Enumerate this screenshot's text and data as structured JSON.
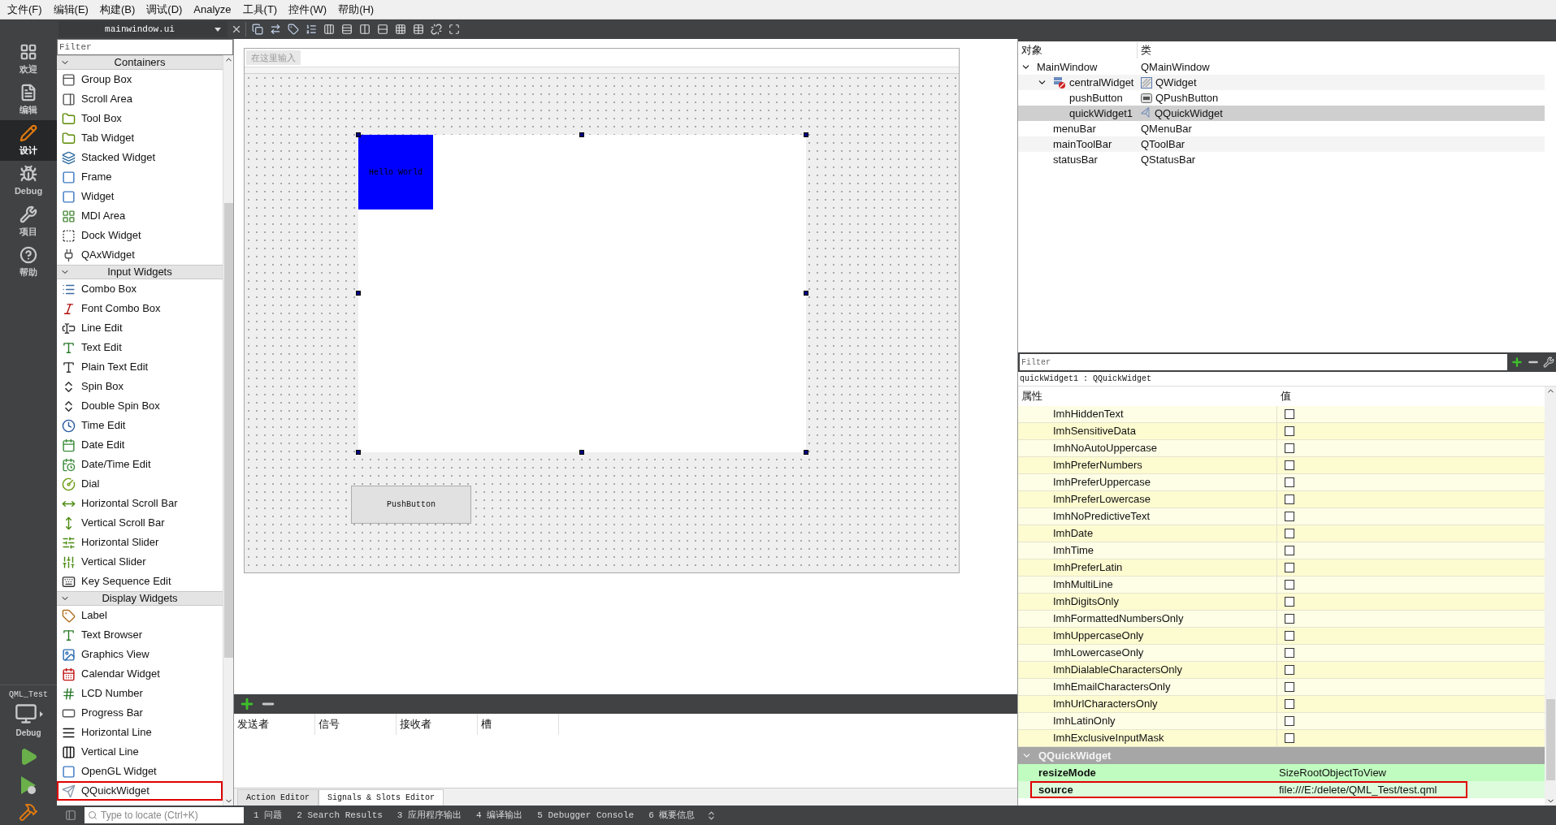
{
  "menu_bar": [
    "文件(F)",
    "编辑(E)",
    "构建(B)",
    "调试(D)",
    "Analyze",
    "工具(T)",
    "控件(W)",
    "帮助(H)"
  ],
  "editor_toolbar": {
    "file": "mainwindow.ui"
  },
  "mode_bar": [
    {
      "label": "欢迎",
      "selected": false
    },
    {
      "label": "编辑",
      "selected": false
    },
    {
      "label": "设计",
      "selected": true
    },
    {
      "label": "Debug",
      "selected": false
    },
    {
      "label": "项目",
      "selected": false
    },
    {
      "label": "帮助",
      "selected": false
    }
  ],
  "kit": {
    "project": "QML_Test",
    "build": "Debug"
  },
  "widget_box": {
    "filter": {
      "placeholder": "Filter"
    },
    "categories": [
      {
        "title": "Containers",
        "expanded": true,
        "items": [
          {
            "label": "Group Box",
            "highlighted": false
          },
          {
            "label": "Scroll Area",
            "highlighted": false
          },
          {
            "label": "Tool Box",
            "highlighted": false
          },
          {
            "label": "Tab Widget",
            "highlighted": false
          },
          {
            "label": "Stacked Widget",
            "highlighted": false
          },
          {
            "label": "Frame",
            "highlighted": false
          },
          {
            "label": "Widget",
            "highlighted": false
          },
          {
            "label": "MDI Area",
            "highlighted": false
          },
          {
            "label": "Dock Widget",
            "highlighted": false
          },
          {
            "label": "QAxWidget",
            "highlighted": false
          }
        ]
      },
      {
        "title": "Input Widgets",
        "expanded": true,
        "items": [
          {
            "label": "Combo Box",
            "highlighted": false
          },
          {
            "label": "Font Combo Box",
            "highlighted": false
          },
          {
            "label": "Line Edit",
            "highlighted": false
          },
          {
            "label": "Text Edit",
            "highlighted": false
          },
          {
            "label": "Plain Text Edit",
            "highlighted": false
          },
          {
            "label": "Spin Box",
            "highlighted": false
          },
          {
            "label": "Double Spin Box",
            "highlighted": false
          },
          {
            "label": "Time Edit",
            "highlighted": false
          },
          {
            "label": "Date Edit",
            "highlighted": false
          },
          {
            "label": "Date/Time Edit",
            "highlighted": false
          },
          {
            "label": "Dial",
            "highlighted": false
          },
          {
            "label": "Horizontal Scroll Bar",
            "highlighted": false
          },
          {
            "label": "Vertical Scroll Bar",
            "highlighted": false
          },
          {
            "label": "Horizontal Slider",
            "highlighted": false
          },
          {
            "label": "Vertical Slider",
            "highlighted": false
          },
          {
            "label": "Key Sequence Edit",
            "highlighted": false
          }
        ]
      },
      {
        "title": "Display Widgets",
        "expanded": true,
        "items": [
          {
            "label": "Label",
            "highlighted": false
          },
          {
            "label": "Text Browser",
            "highlighted": false
          },
          {
            "label": "Graphics View",
            "highlighted": false
          },
          {
            "label": "Calendar Widget",
            "highlighted": false
          },
          {
            "label": "LCD Number",
            "highlighted": false
          },
          {
            "label": "Progress Bar",
            "highlighted": false
          },
          {
            "label": "Horizontal Line",
            "highlighted": false
          },
          {
            "label": "Vertical Line",
            "highlighted": false
          },
          {
            "label": "OpenGL Widget",
            "highlighted": false
          },
          {
            "label": "QQuickWidget",
            "highlighted": true
          }
        ]
      }
    ]
  },
  "form": {
    "menu_placeholder": "在这里输入",
    "quick_text": "Hello World",
    "push_button": "PushButton"
  },
  "signal_slot": {
    "columns": [
      "发送者",
      "信号",
      "接收者",
      "槽"
    ],
    "tabs": [
      {
        "label": "Action Editor",
        "selected": false
      },
      {
        "label": "Signals & Slots Editor",
        "selected": true
      }
    ]
  },
  "object_inspector": {
    "columns": [
      "对象",
      "类"
    ],
    "tree": [
      {
        "name": "MainWindow",
        "class": "QMainWindow",
        "expanded": true,
        "selected": false,
        "children": [
          {
            "name": "centralWidget",
            "class": "QWidget",
            "kind": "central",
            "expanded": true,
            "selected": false,
            "children": [
              {
                "name": "pushButton",
                "class": "QPushButton",
                "kind": "button",
                "selected": false
              },
              {
                "name": "quickWidget1",
                "class": "QQuickWidget",
                "kind": "quick",
                "selected": true
              }
            ]
          },
          {
            "name": "menuBar",
            "class": "QMenuBar",
            "selected": false
          },
          {
            "name": "mainToolBar",
            "class": "QToolBar",
            "selected": false
          },
          {
            "name": "statusBar",
            "class": "QStatusBar",
            "selected": false
          }
        ]
      }
    ]
  },
  "property_editor": {
    "filter": {
      "placeholder": "Filter"
    },
    "object_label": "quickWidget1 : QQuickWidget",
    "columns": [
      "属性",
      "值"
    ],
    "flags": [
      {
        "name": "ImhHiddenText",
        "checked": false
      },
      {
        "name": "ImhSensitiveData",
        "checked": false
      },
      {
        "name": "ImhNoAutoUppercase",
        "checked": false
      },
      {
        "name": "ImhPreferNumbers",
        "checked": false
      },
      {
        "name": "ImhPreferUppercase",
        "checked": false
      },
      {
        "name": "ImhPreferLowercase",
        "checked": false
      },
      {
        "name": "ImhNoPredictiveText",
        "checked": false
      },
      {
        "name": "ImhDate",
        "checked": false
      },
      {
        "name": "ImhTime",
        "checked": false
      },
      {
        "name": "ImhPreferLatin",
        "checked": false
      },
      {
        "name": "ImhMultiLine",
        "checked": false
      },
      {
        "name": "ImhDigitsOnly",
        "checked": false
      },
      {
        "name": "ImhFormattedNumbersOnly",
        "checked": false
      },
      {
        "name": "ImhUppercaseOnly",
        "checked": false
      },
      {
        "name": "ImhLowercaseOnly",
        "checked": false
      },
      {
        "name": "ImhDialableCharactersOnly",
        "checked": false
      },
      {
        "name": "ImhEmailCharactersOnly",
        "checked": false
      },
      {
        "name": "ImhUrlCharactersOnly",
        "checked": false
      },
      {
        "name": "ImhLatinOnly",
        "checked": false
      },
      {
        "name": "ImhExclusiveInputMask",
        "checked": false
      }
    ],
    "group": {
      "title": "QQuickWidget",
      "expanded": true
    },
    "properties": [
      {
        "name": "resizeMode",
        "value": "SizeRootObjectToView",
        "highlighted": false
      },
      {
        "name": "source",
        "value": "file:///E:/delete/QML_Test/test.qml",
        "highlighted": true
      }
    ]
  },
  "locator": {
    "placeholder": "Type to locate (Ctrl+K)"
  },
  "output_panes": [
    {
      "number": "1",
      "label": "问题"
    },
    {
      "number": "2",
      "label": "Search Results"
    },
    {
      "number": "3",
      "label": "应用程序输出"
    },
    {
      "number": "4",
      "label": "编译输出"
    },
    {
      "number": "5",
      "label": "Debugger Console"
    },
    {
      "number": "6",
      "label": "概要信息"
    }
  ]
}
